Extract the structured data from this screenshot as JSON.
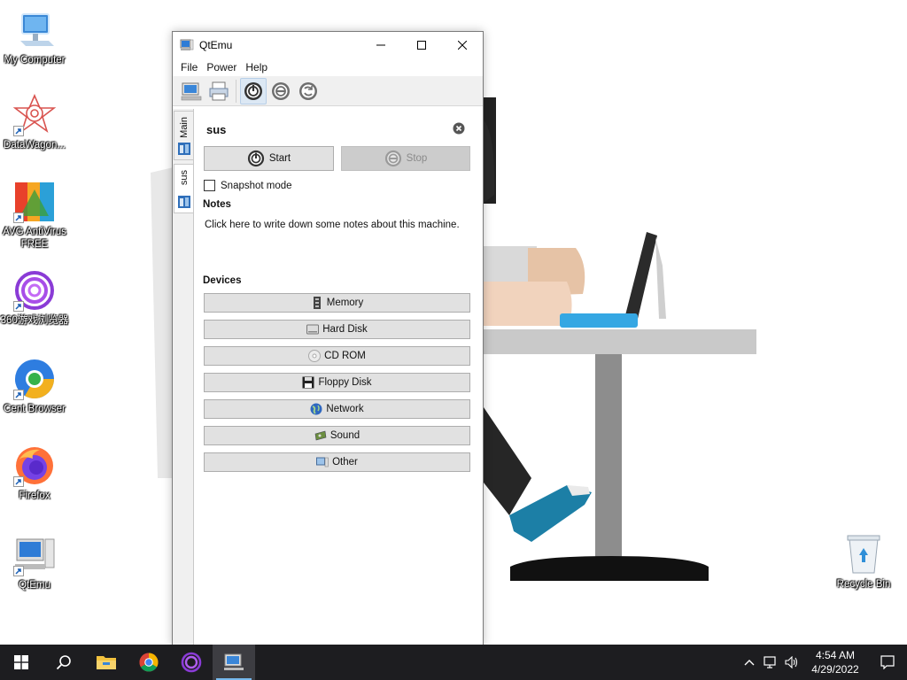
{
  "desktop": {
    "icons": [
      {
        "label": "My Computer",
        "icon": "computer-icon"
      },
      {
        "label": "DataWagon...",
        "icon": "datawagon-icon"
      },
      {
        "label": "AVG AntiVirus FREE",
        "icon": "avg-icon"
      },
      {
        "label": "360游戏浏览器",
        "icon": "360-browser-icon"
      },
      {
        "label": "Cent Browser",
        "icon": "cent-browser-icon"
      },
      {
        "label": "Firefox",
        "icon": "firefox-icon"
      },
      {
        "label": "QtEmu",
        "icon": "qtemu-icon"
      },
      {
        "label": "Recycle Bin",
        "icon": "recycle-bin-icon"
      }
    ]
  },
  "window": {
    "title": "QtEmu",
    "menu": [
      "File",
      "Power",
      "Help"
    ],
    "side_tabs": [
      "Main",
      "sus"
    ],
    "machine_name": "sus",
    "start_label": "Start",
    "stop_label": "Stop",
    "snapshot_label": "Snapshot mode",
    "snapshot_checked": false,
    "notes_label": "Notes",
    "notes_placeholder": "Click here to write down some notes about this machine.",
    "devices_label": "Devices",
    "devices": [
      "Memory",
      "Hard Disk",
      "CD ROM",
      "Floppy Disk",
      "Network",
      "Sound",
      "Other"
    ]
  },
  "taskbar": {
    "time": "4:54 AM",
    "date": "4/29/2022",
    "pinned": [
      "start-icon",
      "search-icon",
      "file-explorer-icon",
      "chrome-icon",
      "360-browser-icon",
      "qtemu-icon"
    ]
  },
  "colors": {
    "taskbar": "#1d1d20",
    "accent": "#76b9ed",
    "button_face": "#e1e1e1"
  }
}
